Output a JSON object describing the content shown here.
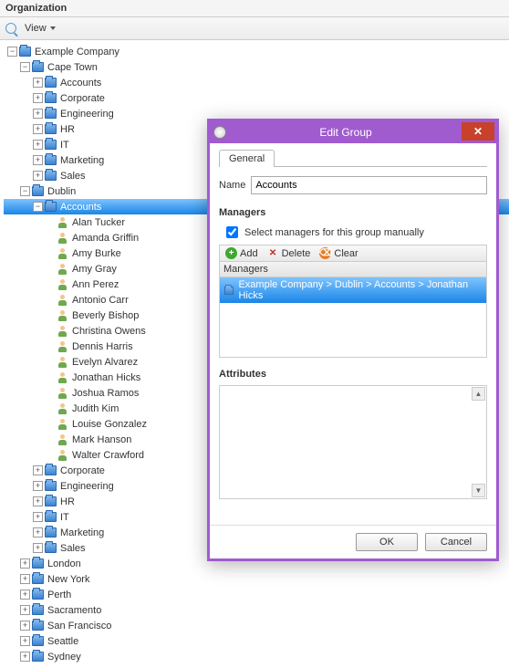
{
  "panel": {
    "title": "Organization"
  },
  "toolbar": {
    "view_label": "View"
  },
  "tree": {
    "root": "Example Company",
    "cape_town": {
      "label": "Cape Town",
      "children": [
        "Accounts",
        "Corporate",
        "Engineering",
        "HR",
        "IT",
        "Marketing",
        "Sales"
      ]
    },
    "dublin": {
      "label": "Dublin",
      "accounts": {
        "label": "Accounts",
        "people": [
          "Alan Tucker",
          "Amanda Griffin",
          "Amy Burke",
          "Amy Gray",
          "Ann Perez",
          "Antonio Carr",
          "Beverly Bishop",
          "Christina Owens",
          "Dennis Harris",
          "Evelyn Alvarez",
          "Jonathan Hicks",
          "Joshua Ramos",
          "Judith Kim",
          "Louise Gonzalez",
          "Mark Hanson",
          "Walter Crawford"
        ]
      },
      "rest": [
        "Corporate",
        "Engineering",
        "HR",
        "IT",
        "Marketing",
        "Sales"
      ]
    },
    "cities": [
      "London",
      "New York",
      "Perth",
      "Sacramento",
      "San Francisco",
      "Seattle",
      "Sydney"
    ]
  },
  "dialog": {
    "title": "Edit Group",
    "tab_general": "General",
    "name_label": "Name",
    "name_value": "Accounts",
    "managers_label": "Managers",
    "checkbox_label": "Select managers for this group manually",
    "checkbox_checked": true,
    "btn_add": "Add",
    "btn_delete": "Delete",
    "btn_clear": "Clear",
    "grid_header": "Managers",
    "grid_row": "Example Company > Dublin > Accounts > Jonathan Hicks",
    "attributes_label": "Attributes",
    "ok": "OK",
    "cancel": "Cancel"
  }
}
